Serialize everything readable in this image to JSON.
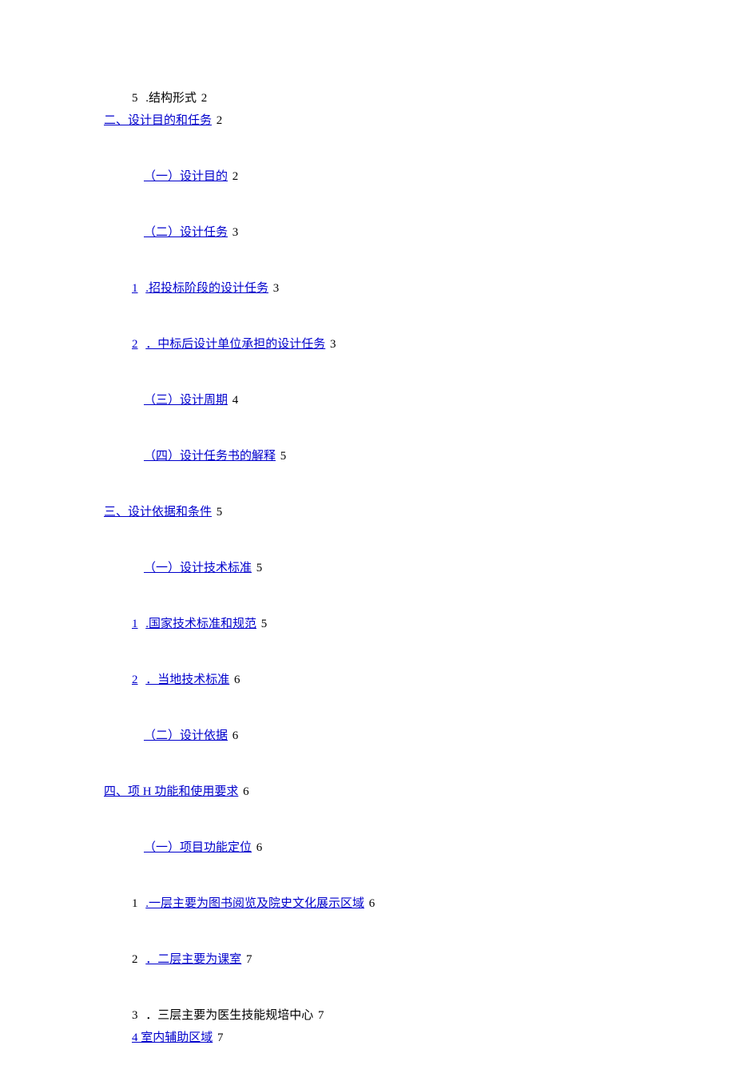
{
  "items": [
    {
      "pad": "pad-165",
      "num": "5",
      "numStyle": "plain",
      "text": ".结构形式",
      "textStyle": "plain",
      "page": "2",
      "tight": true
    },
    {
      "pad": "pad-130",
      "num": "",
      "numStyle": "",
      "text": "二、设计目的和任务",
      "textStyle": "link",
      "page": "2",
      "tight": false
    },
    {
      "pad": "pad-180",
      "num": "",
      "numStyle": "",
      "text": "（一）设计目的",
      "textStyle": "link",
      "page": "2",
      "tight": false
    },
    {
      "pad": "pad-180",
      "num": "",
      "numStyle": "",
      "text": "（二）设计任务",
      "textStyle": "link",
      "page": "3",
      "tight": false
    },
    {
      "pad": "pad-165",
      "num": "1",
      "numStyle": "num",
      "text": ".招投标阶段的设计任务",
      "textStyle": "link",
      "page": "3",
      "tight": false
    },
    {
      "pad": "pad-165",
      "num": "2",
      "numStyle": "num",
      "text": "．中标后设计单位承担的设计任务",
      "textStyle": "link",
      "page": "3",
      "tight": false
    },
    {
      "pad": "pad-180",
      "num": "",
      "numStyle": "",
      "text": "（三）设计周期",
      "textStyle": "link",
      "page": "4",
      "tight": false
    },
    {
      "pad": "pad-180",
      "num": "",
      "numStyle": "",
      "text": "（四）设计任务书的解释",
      "textStyle": "link",
      "page": "5",
      "tight": false
    },
    {
      "pad": "pad-130",
      "num": "",
      "numStyle": "",
      "text": "三、设计依据和条件",
      "textStyle": "link",
      "page": "5",
      "tight": false
    },
    {
      "pad": "pad-180",
      "num": "",
      "numStyle": "",
      "text": "（一）设计技术标准",
      "textStyle": "link",
      "page": "5",
      "tight": false
    },
    {
      "pad": "pad-165",
      "num": "1",
      "numStyle": "num",
      "text": ".国家技术标准和规范",
      "textStyle": "link",
      "page": "5",
      "tight": false
    },
    {
      "pad": "pad-165",
      "num": "2",
      "numStyle": "num",
      "text": "．当地技术标准",
      "textStyle": "link",
      "page": "6",
      "tight": false
    },
    {
      "pad": "pad-180",
      "num": "",
      "numStyle": "",
      "text": "（二）设计依据",
      "textStyle": "link",
      "page": "6",
      "tight": false
    },
    {
      "pad": "pad-130",
      "num": "",
      "numStyle": "",
      "text": "四、项 H 功能和使用要求",
      "textStyle": "link",
      "page": "6",
      "tight": false
    },
    {
      "pad": "pad-180",
      "num": "",
      "numStyle": "",
      "text": "（一）项目功能定位",
      "textStyle": "link",
      "page": "6",
      "tight": false
    },
    {
      "pad": "pad-165",
      "num": "1",
      "numStyle": "num-black",
      "text": ".一层主要为图书阅览及院史文化展示区域",
      "textStyle": "link",
      "page": "6",
      "tight": false
    },
    {
      "pad": "pad-165",
      "num": "2",
      "numStyle": "num-black",
      "text": "．二层主要为课室",
      "textStyle": "link",
      "page": "7",
      "tight": false
    },
    {
      "pad": "pad-165",
      "num": "3",
      "numStyle": "num-black",
      "text": "．三层主要为医生技能规培中心",
      "textStyle": "plain",
      "page": "7",
      "tight": true
    },
    {
      "pad": "pad-165",
      "num": "",
      "numStyle": "",
      "text": "4 室内辅助区域",
      "textStyle": "link",
      "page": "7",
      "tight": false
    }
  ]
}
